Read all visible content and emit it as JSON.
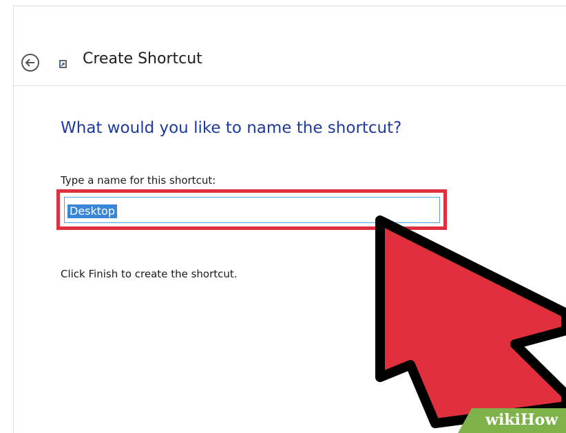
{
  "window": {
    "title": "Create Shortcut"
  },
  "content": {
    "heading": "What would you like to name the shortcut?",
    "name_field_label": "Type a name for this shortcut:",
    "name_field_value": "Desktop",
    "instruction": "Click Finish to create the shortcut."
  },
  "overlay": {
    "watermark_text": "wikiHow",
    "highlight_color": "#e0303e",
    "cursor_color": "#e0303e"
  },
  "icons": {
    "back": "back-arrow-icon",
    "shortcut": "shortcut-icon"
  },
  "colors": {
    "heading": "#1f3a9a",
    "selection": "#3a86d6",
    "input_border": "#5aa0d8"
  }
}
